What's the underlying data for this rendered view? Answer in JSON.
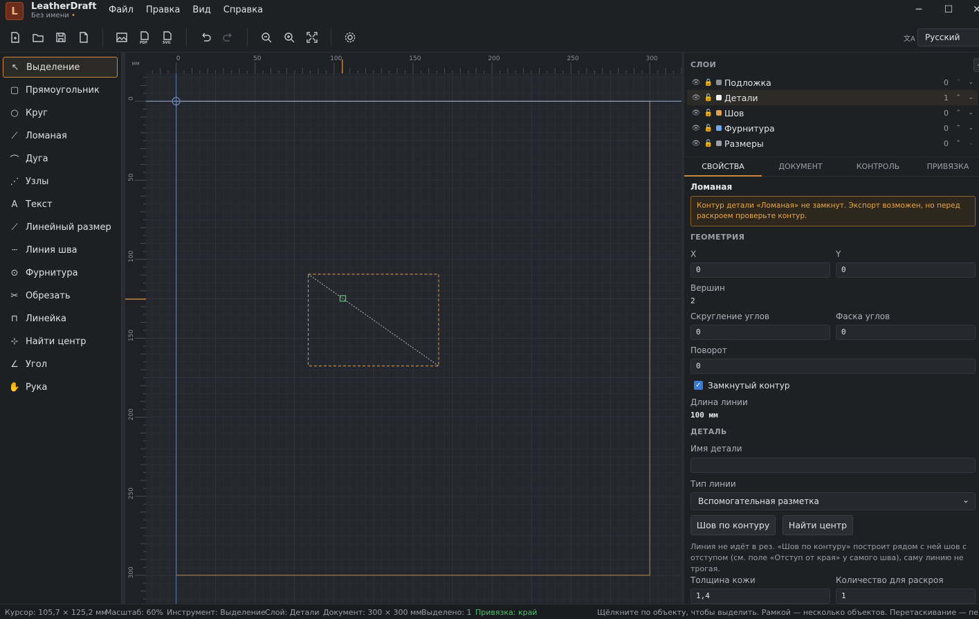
{
  "app": {
    "name": "LeatherDraft",
    "doc": "Без имени",
    "dot": "•",
    "logo": "L"
  },
  "menu": [
    "Файл",
    "Правка",
    "Вид",
    "Справка"
  ],
  "window": {
    "minimize": "─",
    "maximize": "☐",
    "close": "✕"
  },
  "toolbar": {
    "language": "Русский"
  },
  "tools": [
    {
      "label": "Выделение",
      "icon": "cursor-icon",
      "glyph": "↖"
    },
    {
      "label": "Прямоугольник",
      "icon": "rectangle-icon",
      "glyph": "▢"
    },
    {
      "label": "Круг",
      "icon": "circle-icon",
      "glyph": "○"
    },
    {
      "label": "Ломаная",
      "icon": "polyline-icon",
      "glyph": "⟋"
    },
    {
      "label": "Дуга",
      "icon": "arc-icon",
      "glyph": "⌒"
    },
    {
      "label": "Узлы",
      "icon": "nodes-icon",
      "glyph": "⋰"
    },
    {
      "label": "Текст",
      "icon": "text-icon",
      "glyph": "A"
    },
    {
      "label": "Линейный размер",
      "icon": "ruler-icon",
      "glyph": "⟋"
    },
    {
      "label": "Линия шва",
      "icon": "stitch-line-icon",
      "glyph": "┄"
    },
    {
      "label": "Фурнитура",
      "icon": "hardware-icon",
      "glyph": "⊙"
    },
    {
      "label": "Обрезать",
      "icon": "scissors-icon",
      "glyph": "✂"
    },
    {
      "label": "Линейка",
      "icon": "ruler-square-icon",
      "glyph": "⊓"
    },
    {
      "label": "Найти центр",
      "icon": "find-center-icon",
      "glyph": "⊹"
    },
    {
      "label": "Угол",
      "icon": "angle-icon",
      "glyph": "∠"
    },
    {
      "label": "Рука",
      "icon": "hand-icon",
      "glyph": "✋"
    }
  ],
  "rulers": {
    "unit": "мм",
    "h": [
      "0",
      "50",
      "100",
      "150",
      "200",
      "250",
      "300"
    ],
    "v": [
      "0",
      "50",
      "100",
      "150",
      "200",
      "250",
      "300"
    ]
  },
  "layers": {
    "title": "СЛОИ",
    "add": "+",
    "items": [
      {
        "name": "Подложка",
        "count": "0",
        "color": "#8a8f96"
      },
      {
        "name": "Детали",
        "count": "1",
        "color": "#f2f2f2"
      },
      {
        "name": "Шов",
        "count": "0",
        "color": "#e0a050"
      },
      {
        "name": "Фурнитура",
        "count": "0",
        "color": "#6aa8e6"
      },
      {
        "name": "Размеры",
        "count": "0",
        "color": "#9aa0a8"
      }
    ]
  },
  "tabs": [
    "СВОЙСТВА",
    "ДОКУМЕНТ",
    "КОНТРОЛЬ",
    "ПРИВЯЗКА"
  ],
  "props": {
    "object": "Ломаная",
    "warning": "Контур детали «Ломаная» не замкнут. Экспорт возможен, но перед раскроем проверьте контур.",
    "geom_title": "ГЕОМЕТРИЯ",
    "x_label": "X",
    "x": "0",
    "y_label": "Y",
    "y": "0",
    "vertices_label": "Вершин",
    "vertices": "2",
    "round_label": "Скругление углов",
    "round": "0",
    "chamfer_label": "Фаска углов",
    "chamfer": "0",
    "rot_label": "Поворот",
    "rot": "0",
    "closed_label": "Замкнутый контур",
    "closed": true,
    "len_label": "Длина линии",
    "len": "100 мм",
    "detail_title": "ДЕТАЛЬ",
    "name_label": "Имя детали",
    "name": "",
    "type_label": "Тип линии",
    "type": "Вспомогательная разметка",
    "btn_seam": "Шов по контуру",
    "btn_center": "Найти центр",
    "note": "Линия не идёт в рез. «Шов по контуру» построит рядом с ней шов с отступом (см. поле «Отступ от края» у самого шва), саму линию не трогая.",
    "thick_label": "Толщина кожи",
    "thick": "1,4",
    "qty_label": "Количество для раскроя",
    "qty": "1"
  },
  "status": {
    "cursor": "Курсор: 105,7 × 125,2 мм",
    "scale": "Масштаб: 60%",
    "tool": "Инструмент: Выделение",
    "layer": "Слой: Детали",
    "doc": "Документ: 300 × 300 мм",
    "selected": "Выделено: 1",
    "snap": "Привязка: край",
    "hint": "Щёлкните по объекту, чтобы выделить. Рамкой — несколько объектов. Перетаскивание — перемещение"
  },
  "colors": {
    "accent": "#c98a3e",
    "snap": "#4fc36b",
    "warn": "#e8a848",
    "guide": "#6a8ab8"
  }
}
